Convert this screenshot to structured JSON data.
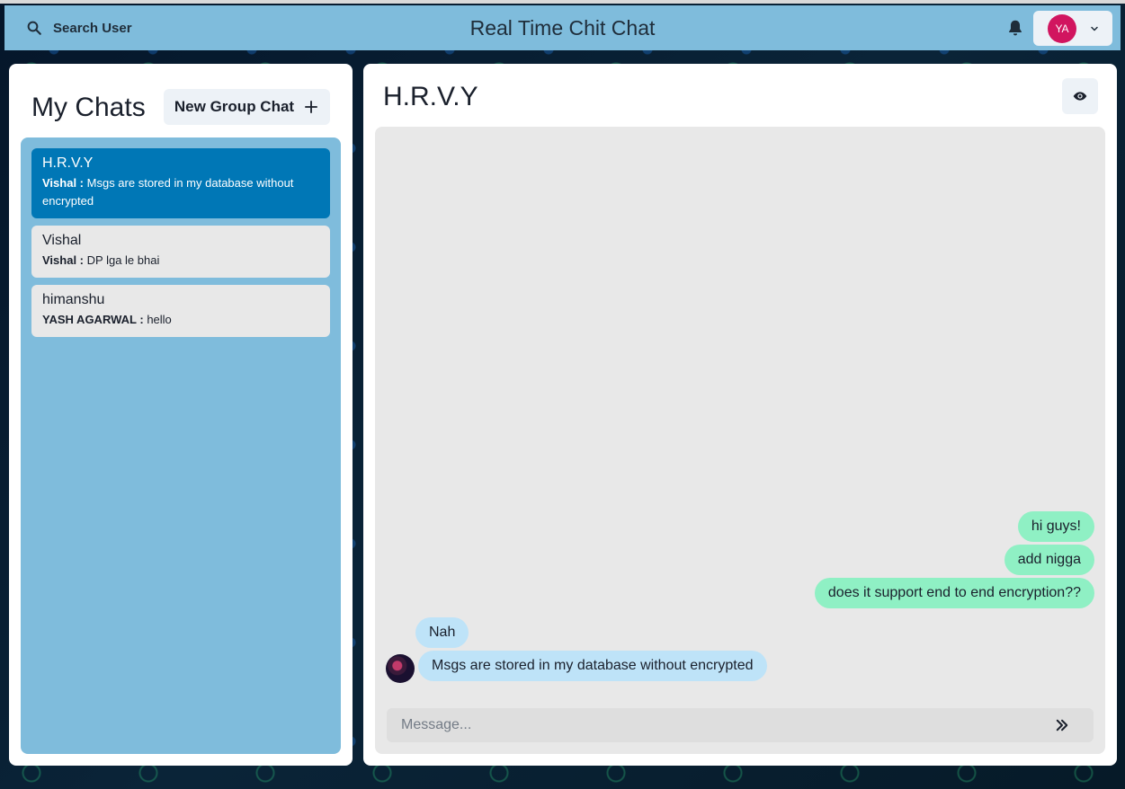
{
  "header": {
    "search_label": "Search User",
    "title": "Real Time Chit Chat",
    "profile_initials": "YA"
  },
  "sidebar": {
    "title": "My Chats",
    "new_group_label": "New Group Chat",
    "chats": [
      {
        "name": "H.R.V.Y",
        "sender": "Vishal :",
        "preview": "Msgs are stored in my database without encrypted",
        "active": true
      },
      {
        "name": "Vishal",
        "sender": "Vishal :",
        "preview": "DP lga le bhai",
        "active": false
      },
      {
        "name": "himanshu",
        "sender": "YASH AGARWAL :",
        "preview": "hello",
        "active": false
      }
    ]
  },
  "chat": {
    "title": "H.R.V.Y",
    "messages": [
      {
        "text": "hi guys!",
        "direction": "out"
      },
      {
        "text": "add nigga",
        "direction": "out"
      },
      {
        "text": "does it support end to end encryption??",
        "direction": "out"
      },
      {
        "text": "Nah",
        "direction": "in"
      },
      {
        "text": "Msgs are stored in my database without encrypted",
        "direction": "in"
      }
    ],
    "input_placeholder": "Message..."
  },
  "icons": {
    "search": "search-icon",
    "bell": "bell-icon",
    "chevron": "chevron-down-icon",
    "plus": "plus-icon",
    "eye": "eye-icon",
    "send": "double-chevron-right-icon"
  },
  "colors": {
    "header": "#7fbcdc",
    "active_chat": "#0077b6",
    "outgoing_bubble": "#8ff0c4",
    "incoming_bubble": "#bee3f8",
    "avatar": "#d1155f"
  }
}
